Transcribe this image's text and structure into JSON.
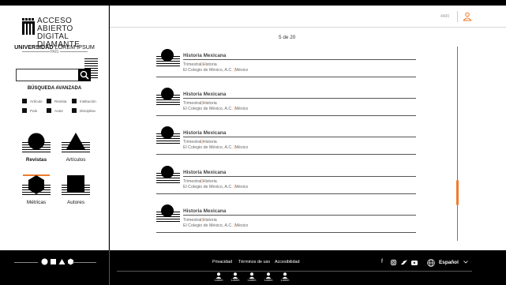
{
  "brand": {
    "line1": "ACCESO ABIERTO",
    "line2": "DIGITAL DIAMANTE",
    "uni_bold": "UNIVERSIDAD",
    "uni_rest": "LOREM IPSUM",
    "country": "PAÍS"
  },
  "search": {
    "placeholder": "",
    "advanced_label": "BÚSQUEDA AVANZADA"
  },
  "filters": [
    "Artículo",
    "Revista",
    "Institución",
    "País",
    "Autor",
    "Disciplina"
  ],
  "nav": {
    "revistas": "Revistas",
    "articulos": "Artículos",
    "metricas": "Métricas",
    "autores": "Autores"
  },
  "header": {
    "user_text": "4400"
  },
  "pager": "5 de 20",
  "results": [
    {
      "title": "Historia Mexicana",
      "frequency": "Trimestral",
      "subject": "Historia",
      "publisher": "El Colegio de México, A.C.",
      "country": "México"
    },
    {
      "title": "Historia Mexicana",
      "frequency": "Trimestral",
      "subject": "Historia",
      "publisher": "El Colegio de México, A.C.",
      "country": "México"
    },
    {
      "title": "Historia Mexicana",
      "frequency": "Trimestral",
      "subject": "Historia",
      "publisher": "El Colegio de México, A.C.",
      "country": "México"
    },
    {
      "title": "Historia Mexicana",
      "frequency": "Trimestral",
      "subject": "Historia",
      "publisher": "El Colegio de México, A.C.",
      "country": "México"
    },
    {
      "title": "Historia Mexicana",
      "frequency": "Trimestral",
      "subject": "Historia",
      "publisher": "El Colegio de México, A.C.",
      "country": "México"
    }
  ],
  "footer": {
    "links": [
      "Privacidad",
      "Términos de uso",
      "Accesibilidad"
    ],
    "language": "Español",
    "social_icons": [
      "facebook-icon",
      "instagram-icon",
      "twitter-icon",
      "youtube-icon"
    ],
    "avatars": [
      "Lorem",
      "Lorem",
      "Lorem",
      "Lorem",
      "Lorem"
    ]
  },
  "colors": {
    "accent": "#f07b2c",
    "black": "#000000"
  }
}
